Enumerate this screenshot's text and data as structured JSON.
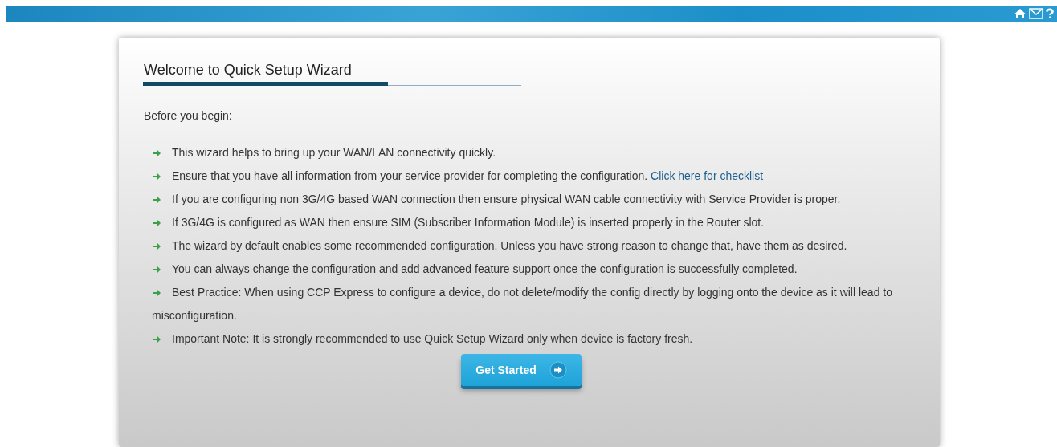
{
  "wizard": {
    "title": "Welcome to Quick Setup Wizard",
    "intro": "Before you begin:",
    "items": [
      {
        "text": "This wizard helps to bring up your WAN/LAN connectivity quickly."
      },
      {
        "text": "Ensure that you have all information from your service provider for completing the configuration.",
        "link": "Click here for checklist"
      },
      {
        "text": "If you are configuring non 3G/4G based WAN connection then ensure physical WAN cable connectivity with Service Provider is proper."
      },
      {
        "text": "If 3G/4G is configured as WAN then ensure SIM (Subscriber Information Module) is inserted properly in the Router slot."
      },
      {
        "text": "The wizard by default enables some recommended configuration. Unless you have strong reason to change that, have them as desired."
      },
      {
        "text": "You can always change the configuration and add advanced feature support once the configuration is successfully completed."
      },
      {
        "text": "Best Practice: When using CCP Express to configure a device, do not delete/modify the config directly by logging onto the device as it will lead to misconfiguration."
      },
      {
        "text": "Important Note: It is strongly recommended to use Quick Setup Wizard only when device is factory fresh."
      }
    ],
    "button": "Get Started"
  }
}
